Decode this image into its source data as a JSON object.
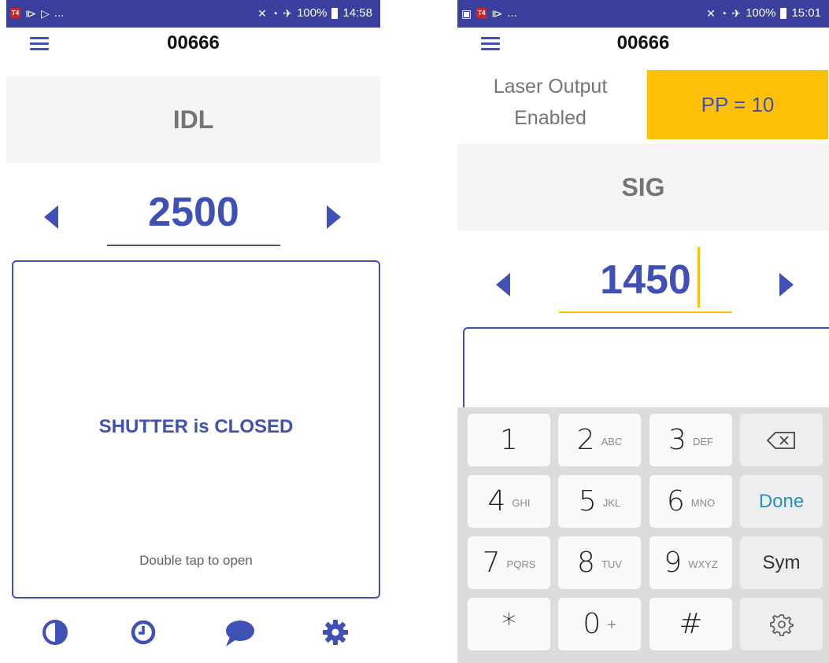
{
  "left_screen": {
    "status": {
      "left_icons": [
        "t4-app-icon",
        "cast-icon",
        "play-icon"
      ],
      "left_more": "...",
      "battery": "100%",
      "time": "14:58"
    },
    "app_title": "00666",
    "mode": "IDL",
    "value": "2500",
    "shutter_state": "SHUTTER is CLOSED",
    "shutter_hint": "Double tap to open",
    "bottom_nav": [
      "contrast-icon",
      "clock-icon",
      "chat-icon",
      "gear-icon"
    ]
  },
  "right_screen": {
    "status": {
      "left_icons": [
        "image-icon",
        "t4-app-icon",
        "cast-icon"
      ],
      "left_more": "...",
      "battery": "100%",
      "time": "15:01"
    },
    "app_title": "00666",
    "laser_status_line1": "Laser Output",
    "laser_status_line2": "Enabled",
    "pp_badge": "PP = 10",
    "mode": "SIG",
    "value": "1450",
    "keyboard": {
      "rows": [
        [
          {
            "d": "1",
            "s": ""
          },
          {
            "d": "2",
            "s": "ABC"
          },
          {
            "d": "3",
            "s": "DEF"
          }
        ],
        [
          {
            "d": "4",
            "s": "GHI"
          },
          {
            "d": "5",
            "s": "JKL"
          },
          {
            "d": "6",
            "s": "MNO"
          }
        ],
        [
          {
            "d": "7",
            "s": "PQRS"
          },
          {
            "d": "8",
            "s": "TUV"
          },
          {
            "d": "9",
            "s": "WXYZ"
          }
        ],
        [
          {
            "d": "*",
            "s": ""
          },
          {
            "d": "0",
            "s": "+"
          },
          {
            "d": "#",
            "s": ""
          }
        ]
      ],
      "done_label": "Done",
      "sym_label": "Sym"
    }
  },
  "colors": {
    "accent": "#3f51b5",
    "status_bar": "#3a3f9e",
    "badge": "#ffc107",
    "gray_text": "#757575"
  }
}
